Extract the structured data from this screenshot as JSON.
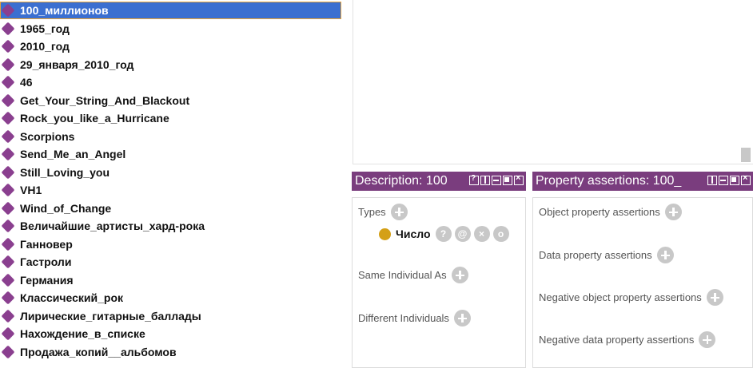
{
  "individuals": [
    {
      "label": "100_миллионов",
      "selected": true
    },
    {
      "label": "1965_год"
    },
    {
      "label": "2010_год"
    },
    {
      "label": "29_января_2010_год"
    },
    {
      "label": "46"
    },
    {
      "label": "Get_Your_String_And_Blackout"
    },
    {
      "label": "Rock_you_like_a_Hurricane"
    },
    {
      "label": "Scorpions"
    },
    {
      "label": "Send_Me_an_Angel"
    },
    {
      "label": "Still_Loving_you"
    },
    {
      "label": "VH1"
    },
    {
      "label": "Wind_of_Change"
    },
    {
      "label": "Величайшие_артисты_хард-рока"
    },
    {
      "label": "Ганновер"
    },
    {
      "label": "Гастроли"
    },
    {
      "label": "Германия"
    },
    {
      "label": "Классический_рок"
    },
    {
      "label": "Лирические_гитарные_баллады"
    },
    {
      "label": "Нахождение_в_списке"
    },
    {
      "label": "Продажа_копий__альбомов"
    }
  ],
  "description_panel": {
    "header": "Description: 100",
    "types_label": "Types",
    "type_item": "Число",
    "type_item_buttons": [
      "?",
      "@",
      "×",
      "o"
    ],
    "same_individual_label": "Same Individual As",
    "different_individuals_label": "Different Individuals"
  },
  "property_panel": {
    "header": "Property assertions: 100_",
    "object_label": "Object property assertions",
    "data_label": "Data property assertions",
    "neg_object_label": "Negative object property assertions",
    "neg_data_label": "Negative data property assertions"
  },
  "colors": {
    "header_bg": "#7a3d7e",
    "selection_bg": "#3b6fd0",
    "selection_border": "#e7a43a",
    "individual_icon": "#8a3f8f",
    "class_dot": "#d4a017"
  }
}
